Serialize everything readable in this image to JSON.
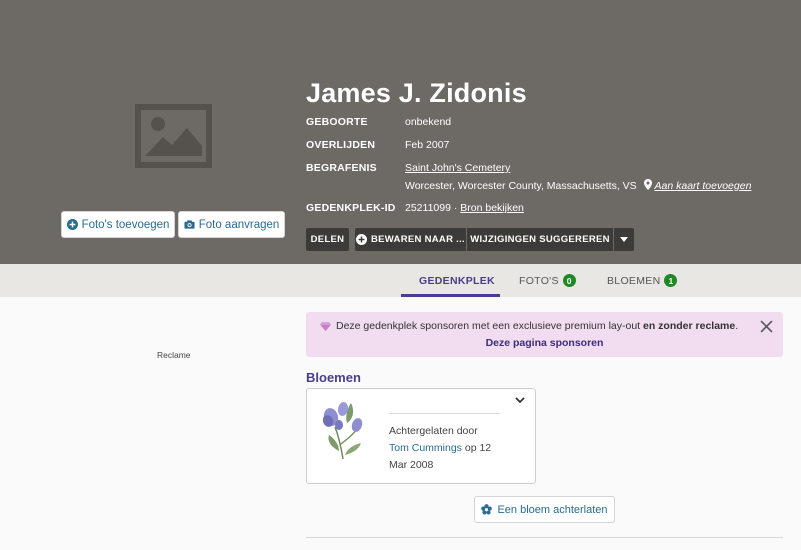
{
  "profile": {
    "name": "James J. Zidonis",
    "facts": [
      {
        "label": "GEBOORTE",
        "value": "onbekend"
      },
      {
        "label": "OVERLIJDEN",
        "value": "Feb 2007"
      },
      {
        "label": "BEGRAFENIS",
        "value": "Saint John's Cemetery",
        "value2": "Worcester, Worcester County, Massachusetts, VS",
        "map_link": "Aan kaart toevoegen"
      },
      {
        "label": "GEDENKPLEK-ID",
        "value": "25211099 ·",
        "source_link": "Bron bekijken"
      }
    ]
  },
  "photo_actions": {
    "add_photos": "Foto's toevoegen",
    "request_photo": "Foto aanvragen"
  },
  "actions": {
    "share": "DELEN",
    "save": "BEWAREN NAAR ...",
    "suggest": "WIJZIGINGEN SUGGEREREN"
  },
  "tabs": [
    {
      "label": "GEDENKPLEK",
      "active": true
    },
    {
      "label": "FOTO'S",
      "count": "0"
    },
    {
      "label": "BLOEMEN",
      "count": "1"
    }
  ],
  "ad_label": "Reclame",
  "sponsor": {
    "text": "Deze gedenkplek sponsoren met een exclusieve premium lay-out",
    "bold_text": "en zonder reclame",
    "suffix": ".",
    "link": "Deze pagina sponsoren"
  },
  "flowers": {
    "title": "Bloemen",
    "left_by": "Achtergelaten door",
    "author": "Tom Cummings",
    "date_prefix": "op 12",
    "date_rest": "Mar 2008",
    "leave_button": "Een bloem achterlaten"
  },
  "colors": {
    "hero": "#6d6a65",
    "accent": "#4a3d8a",
    "link": "#2a6b8f",
    "badge": "#1f8a24",
    "sponsor_bg": "#f2dcf0"
  }
}
